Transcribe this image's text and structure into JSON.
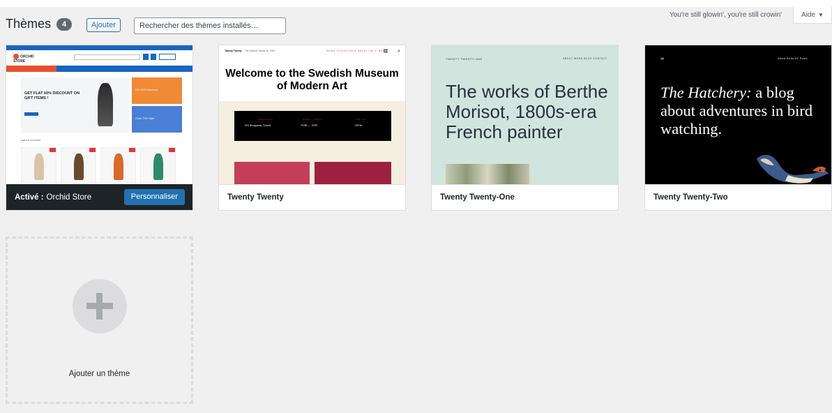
{
  "header": {
    "title": "Thèmes",
    "count": "4",
    "add_button": "Ajouter",
    "search_placeholder": "Rechercher des thèmes installés…",
    "dolly_lyric": "You're still glowin', you're still crowin'",
    "help_label": "Aide"
  },
  "themes": [
    {
      "name": "Orchid Store",
      "active": true,
      "active_prefix": "Activé :",
      "customize_label": "Personnaliser",
      "preview": {
        "logo": "ORCHID STORE",
        "hero_text": "GET FLAT 60% DISCOUNT ON GIFT ITEMS !",
        "promo1": "Get 30% Discount",
        "promo2": "Grab 70% Sale",
        "section": "FEMALE CLOTHING"
      }
    },
    {
      "name": "Twenty Twenty",
      "active": false,
      "preview": {
        "site": "Twenty Twenty",
        "tagline": "The Default Theme for 2020",
        "menu": "Home   Exhibitions   About Us ∨   News",
        "headline": "Welcome to the Swedish Museum of Modern Art",
        "address_h": "ADDRESS",
        "address": "123 Storgatan, Umeå",
        "hours_h": "OPEN TODAY",
        "hours": "9:00 — 5:00",
        "price_h": "PRICE",
        "price": "129 kr"
      }
    },
    {
      "name": "Twenty Twenty-One",
      "active": false,
      "preview": {
        "site": "TWENTY TWENTY-ONE",
        "nav": "ABOUT   WORK   BLOG   CONTACT",
        "headline": "The works of Berthe Morisot, 1800s-era French painter"
      }
    },
    {
      "name": "Twenty Twenty-Two",
      "active": false,
      "preview": {
        "logo": "∞",
        "nav": "About     Birds     All Posts",
        "headline_italic": "The Hatchery:",
        "headline_rest": " a blog about adventures in bird watching."
      }
    }
  ],
  "add_theme_label": "Ajouter un thème",
  "colors": {
    "accent": "#2271b1",
    "background": "#f0f0f1",
    "active_footer": "#1d2327"
  }
}
